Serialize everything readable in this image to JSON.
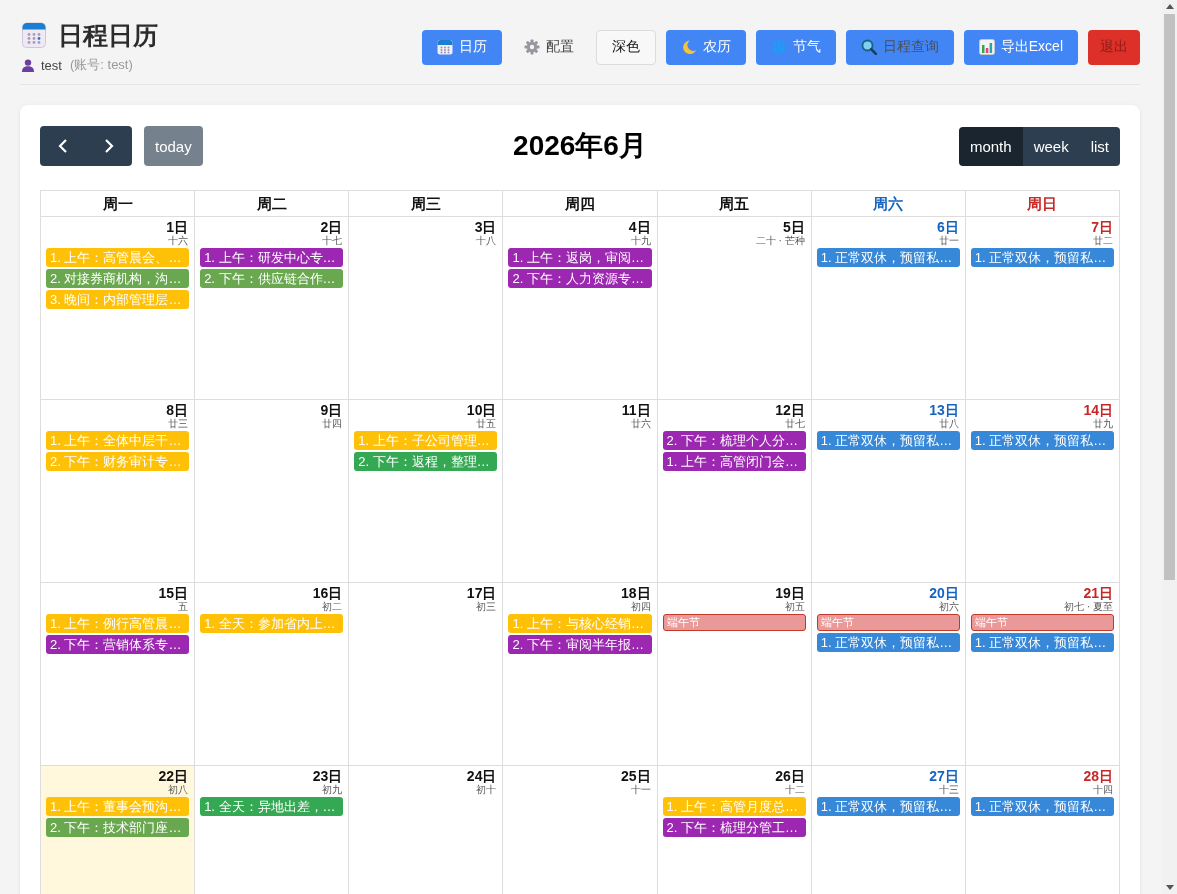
{
  "header": {
    "title": "日程日历",
    "user": "test",
    "account": "(账号: test)",
    "buttons": [
      {
        "label": "日历",
        "kind": "primary"
      },
      {
        "label": "配置",
        "kind": "link"
      },
      {
        "label": "深色",
        "kind": "light"
      },
      {
        "label": "农历",
        "kind": "primary"
      },
      {
        "label": "节气",
        "kind": "primary"
      },
      {
        "label": "日程查询",
        "kind": "muted"
      },
      {
        "label": "导出Excel",
        "kind": "primary"
      },
      {
        "label": "退出",
        "kind": "danger"
      }
    ]
  },
  "calendar": {
    "today_button": {
      "label": "today",
      "disabled": true
    },
    "title": "2026年6月",
    "views": [
      {
        "label": "month",
        "selected": true
      },
      {
        "label": "week",
        "selected": false
      },
      {
        "label": "list",
        "selected": false
      }
    ],
    "weekdays": [
      {
        "label": "周一",
        "kind": "weekday"
      },
      {
        "label": "周二",
        "kind": "weekday"
      },
      {
        "label": "周三",
        "kind": "weekday"
      },
      {
        "label": "周四",
        "kind": "weekday"
      },
      {
        "label": "周五",
        "kind": "weekday"
      },
      {
        "label": "周六",
        "kind": "saturday"
      },
      {
        "label": "周日",
        "kind": "sunday"
      }
    ],
    "weeks": [
      {
        "days": [
          {
            "day": "1日",
            "lunar": "十六",
            "today": false,
            "events": [
              {
                "kind": "event",
                "title": "1. 上午：高管晨会、…",
                "color": "#ffc107"
              },
              {
                "kind": "event",
                "title": "2. 对接券商机构，沟…",
                "color": "#6aa84f"
              },
              {
                "kind": "event",
                "title": "3. 晚间：内部管理层…",
                "color": "#ffc107"
              }
            ]
          },
          {
            "day": "2日",
            "lunar": "十七",
            "today": false,
            "events": [
              {
                "kind": "event",
                "title": "1. 上午：研发中心专…",
                "color": "#9c27b0"
              },
              {
                "kind": "event",
                "title": "2. 下午：供应链合作…",
                "color": "#6aa84f"
              }
            ]
          },
          {
            "day": "3日",
            "lunar": "十八",
            "today": false
          },
          {
            "day": "4日",
            "lunar": "十九",
            "today": false,
            "events": [
              {
                "kind": "event",
                "title": "1. 上午：返岗，审阅…",
                "color": "#9c27b0"
              },
              {
                "kind": "event",
                "title": "2. 下午：人力资源专…",
                "color": "#9c27b0"
              }
            ]
          },
          {
            "day": "5日",
            "lunar": "二十 · 芒种",
            "today": false
          },
          {
            "day": "6日",
            "lunar": "廿一",
            "today": false,
            "events": [
              {
                "kind": "event",
                "title": "1. 正常双休，预留私…",
                "color": "#3788d8"
              }
            ]
          },
          {
            "day": "7日",
            "lunar": "廿二",
            "today": false,
            "events": [
              {
                "kind": "event",
                "title": "1. 正常双休，预留私…",
                "color": "#3788d8"
              }
            ]
          }
        ]
      },
      {
        "days": [
          {
            "day": "8日",
            "lunar": "廿三",
            "today": false,
            "events": [
              {
                "kind": "event",
                "title": "1. 上午：全体中层干…",
                "color": "#ffc107"
              },
              {
                "kind": "event",
                "title": "2. 下午：财务审计专…",
                "color": "#ffc107"
              }
            ]
          },
          {
            "day": "9日",
            "lunar": "廿四",
            "today": false
          },
          {
            "day": "10日",
            "lunar": "廿五",
            "today": false,
            "events": [
              {
                "kind": "event",
                "title": "1. 上午：子公司管理…",
                "color": "#ffc107"
              },
              {
                "kind": "event",
                "title": "2. 下午：返程，整理…",
                "color": "#34a853"
              }
            ]
          },
          {
            "day": "11日",
            "lunar": "廿六",
            "today": false
          },
          {
            "day": "12日",
            "lunar": "廿七",
            "today": false,
            "events": [
              {
                "kind": "event",
                "title": "2. 下午：梳理个人分…",
                "color": "#9c27b0"
              },
              {
                "kind": "event",
                "title": "1. 上午：高管闭门会…",
                "color": "#9c27b0"
              }
            ]
          },
          {
            "day": "13日",
            "lunar": "廿八",
            "today": false,
            "events": [
              {
                "kind": "event",
                "title": "1. 正常双休，预留私…",
                "color": "#3788d8"
              }
            ]
          },
          {
            "day": "14日",
            "lunar": "廿九",
            "today": false,
            "events": [
              {
                "kind": "event",
                "title": "1. 正常双休，预留私…",
                "color": "#3788d8"
              }
            ]
          }
        ]
      },
      {
        "days": [
          {
            "day": "15日",
            "lunar": "五",
            "today": false,
            "events": [
              {
                "kind": "event",
                "title": "1. 上午：例行高管晨…",
                "color": "#ffc107"
              },
              {
                "kind": "event",
                "title": "2. 下午：营销体系专…",
                "color": "#9c27b0"
              }
            ]
          },
          {
            "day": "16日",
            "lunar": "初二",
            "today": false,
            "events": [
              {
                "kind": "event",
                "title": "1. 全天：参加省内上…",
                "color": "#ffc107"
              }
            ]
          },
          {
            "day": "17日",
            "lunar": "初三",
            "today": false
          },
          {
            "day": "18日",
            "lunar": "初四",
            "today": false,
            "events": [
              {
                "kind": "event",
                "title": "1. 上午：与核心经销…",
                "color": "#ffc107"
              },
              {
                "kind": "event",
                "title": "2. 下午：审阅半年报…",
                "color": "#9c27b0"
              }
            ]
          },
          {
            "day": "19日",
            "lunar": "初五",
            "today": false,
            "events": [
              {
                "kind": "holiday",
                "title": "端午节",
                "color": "#ea9999"
              }
            ]
          },
          {
            "day": "20日",
            "lunar": "初六",
            "today": false,
            "events": [
              {
                "kind": "holiday",
                "title": "端午节",
                "color": "#ea9999"
              },
              {
                "kind": "event",
                "title": "1. 正常双休，预留私…",
                "color": "#3788d8"
              }
            ]
          },
          {
            "day": "21日",
            "lunar": "初七 · 夏至",
            "today": false,
            "events": [
              {
                "kind": "holiday",
                "title": "端午节",
                "color": "#ea9999"
              },
              {
                "kind": "event",
                "title": "1. 正常双休，预留私…",
                "color": "#3788d8"
              }
            ]
          }
        ]
      },
      {
        "days": [
          {
            "day": "22日",
            "lunar": "初八",
            "today": true,
            "events": [
              {
                "kind": "event",
                "title": "1. 上午：董事会预沟…",
                "color": "#ffc107"
              },
              {
                "kind": "event",
                "title": "2. 下午：技术部门座…",
                "color": "#6aa84f"
              }
            ]
          },
          {
            "day": "23日",
            "lunar": "初九",
            "today": false,
            "events": [
              {
                "kind": "event",
                "title": "1. 全天：异地出差，…",
                "color": "#34a853"
              }
            ]
          },
          {
            "day": "24日",
            "lunar": "初十",
            "today": false
          },
          {
            "day": "25日",
            "lunar": "十一",
            "today": false
          },
          {
            "day": "26日",
            "lunar": "十二",
            "today": false,
            "events": [
              {
                "kind": "event",
                "title": "1. 上午：高管月度总…",
                "color": "#ffc107"
              },
              {
                "kind": "event",
                "title": "2. 下午：梳理分管工…",
                "color": "#9c27b0"
              }
            ]
          },
          {
            "day": "27日",
            "lunar": "十三",
            "today": false,
            "events": [
              {
                "kind": "event",
                "title": "1. 正常双休，预留私…",
                "color": "#3788d8"
              }
            ]
          },
          {
            "day": "28日",
            "lunar": "十四",
            "today": false,
            "events": [
              {
                "kind": "event",
                "title": "1. 正常双休，预留私…",
                "color": "#3788d8"
              }
            ]
          }
        ]
      }
    ]
  }
}
